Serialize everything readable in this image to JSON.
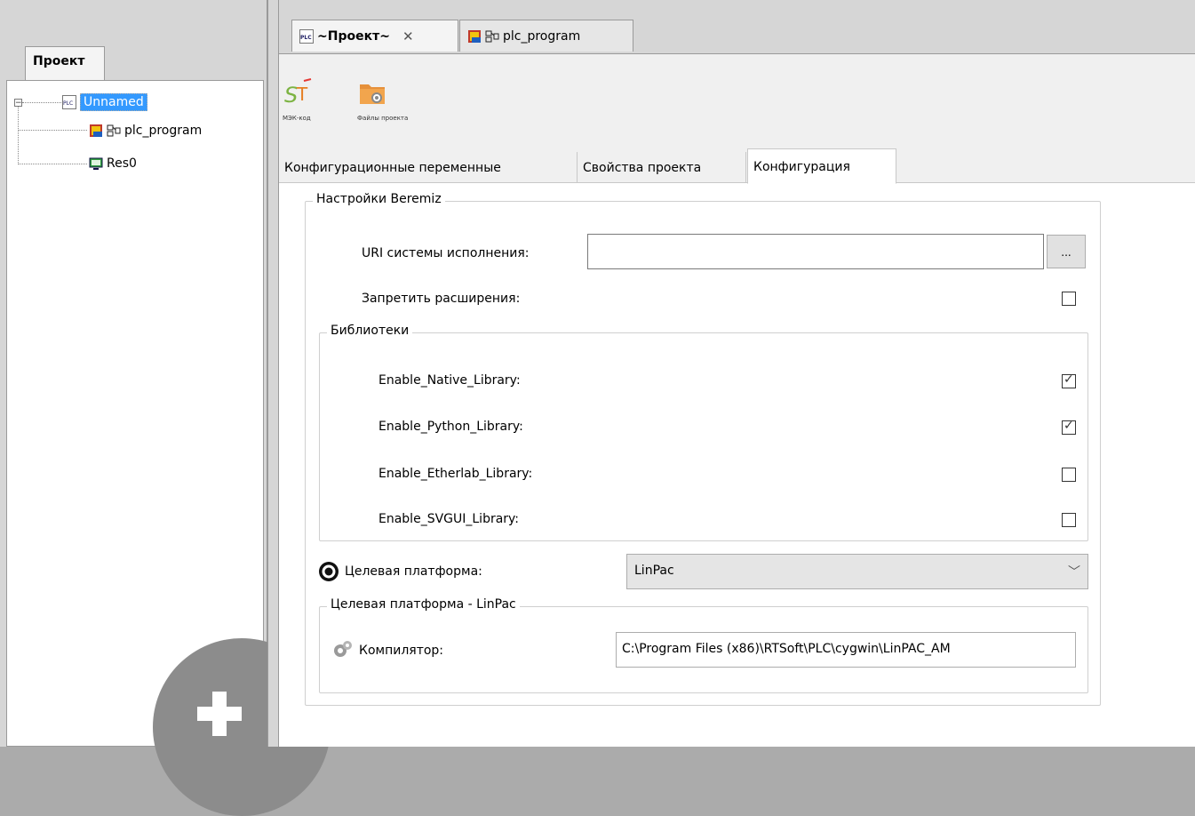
{
  "left_panel": {
    "tab_label": "Проект",
    "tree": {
      "root": "Unnamed",
      "children": [
        "plc_program",
        "Res0"
      ]
    },
    "add_button_icon": "plus-icon"
  },
  "doc_tabs": [
    {
      "label": "~Проект~",
      "close": "✕",
      "icon": "plc-icon"
    },
    {
      "label": "plc_program",
      "icon": "program-icon"
    }
  ],
  "toolbar": {
    "iec_code_label": "МЭК-код",
    "project_files_label": "Файлы проекта"
  },
  "subtabs": [
    "Конфигурационные переменные",
    "Свойства проекта",
    "Конфигурация"
  ],
  "config": {
    "beremiz_group_title": "Настройки Beremiz",
    "uri_label": "URI системы исполнения:",
    "uri_value": "",
    "browse_label": "...",
    "disable_ext_label": "Запретить расширения:",
    "disable_ext_checked": false,
    "libraries_group_title": "Библиотеки",
    "libraries": [
      {
        "label": "Enable_Native_Library:",
        "checked": true
      },
      {
        "label": "Enable_Python_Library:",
        "checked": true
      },
      {
        "label": "Enable_Etherlab_Library:",
        "checked": false
      },
      {
        "label": "Enable_SVGUI_Library:",
        "checked": false
      }
    ],
    "target_label": "Целевая платформа:",
    "target_value": "LinPac",
    "target_group_title": "Целевая платформа - LinPac",
    "compiler_label": "Компилятор:",
    "compiler_value": "C:\\Program Files (x86)\\RTSoft\\PLC\\cygwin\\LinPAC_AM"
  },
  "colors": {
    "selection": "#3399ff",
    "panel_bg": "#d6d6d6"
  }
}
